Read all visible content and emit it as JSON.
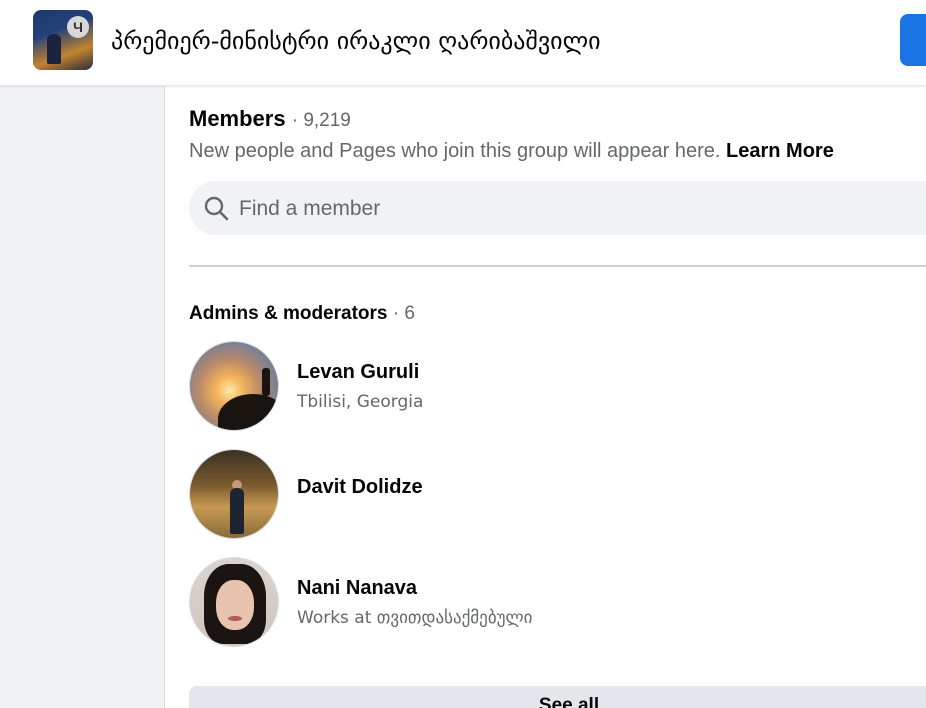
{
  "header": {
    "group_title": "პრემიერ-მინისტრი ირაკლი ღარიბაშვილი",
    "avatar_badge": "Ч"
  },
  "members": {
    "title": "Members",
    "count": "· 9,219",
    "description": "New people and Pages who join this group will appear here.",
    "learn_more": "Learn More"
  },
  "search": {
    "placeholder": "Find a member"
  },
  "admins": {
    "title": "Admins & moderators",
    "count": "· 6",
    "list": [
      {
        "name": "Levan Guruli",
        "subtitle": "Tbilisi, Georgia"
      },
      {
        "name": "Davit Dolidze",
        "subtitle": ""
      },
      {
        "name": "Nani Nanava",
        "subtitle": "Works at თვითდასაქმებული"
      }
    ]
  },
  "see_all": {
    "label": "See all"
  },
  "colors": {
    "accent": "#1b74e4",
    "secondary_text": "#65676b",
    "surface": "#f0f2f5"
  }
}
